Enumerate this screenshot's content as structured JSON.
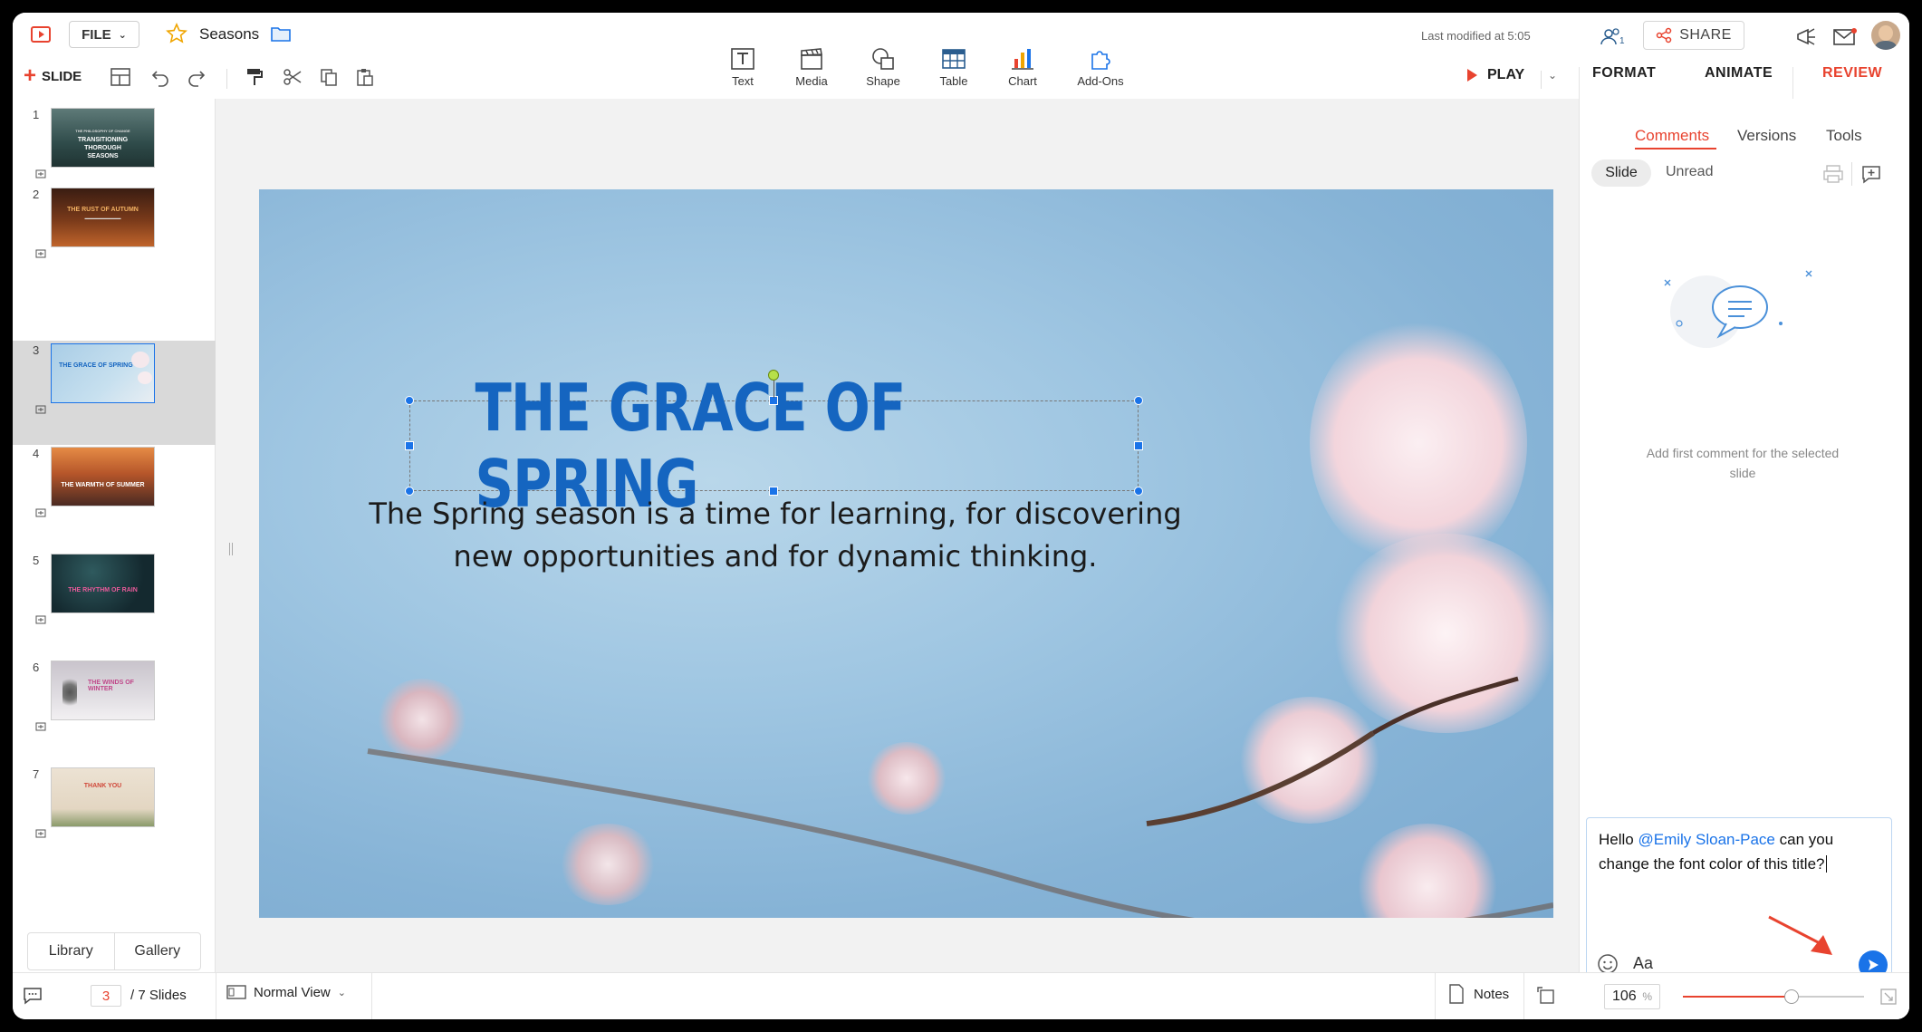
{
  "app": {
    "doc_title": "Seasons",
    "last_modified": "Last modified at 5:05",
    "file_label": "FILE",
    "share_label": "SHARE",
    "collaborators_count": "1"
  },
  "toolbar": {
    "slide_label": "SLIDE",
    "play_label": "PLAY",
    "insert_tools": [
      {
        "label": "Text"
      },
      {
        "label": "Media"
      },
      {
        "label": "Shape"
      },
      {
        "label": "Table"
      },
      {
        "label": "Chart"
      },
      {
        "label": "Add-Ons"
      }
    ]
  },
  "right_tabs": {
    "format": "FORMAT",
    "animate": "ANIMATE",
    "review": "REVIEW",
    "active": "REVIEW"
  },
  "review": {
    "subtabs": [
      "Comments",
      "Versions",
      "Tools"
    ],
    "active_subtab": "Comments",
    "filters": [
      "Slide",
      "Unread"
    ],
    "active_filter": "Slide",
    "empty_state": "Add first comment for the selected slide",
    "comment_draft": {
      "prefix": "Hello ",
      "mention": "@Emily Sloan-Pace",
      "suffix": " can you change the font color of this title?"
    },
    "format_label": "Aa"
  },
  "slides": [
    {
      "number": "1",
      "title": "TRANSITIONING THOROUGH SEASONS",
      "kicker": "THE PHILOSOPHY OF CHANGE"
    },
    {
      "number": "2",
      "title": "THE RUST OF AUTUMN"
    },
    {
      "number": "3",
      "title": "THE GRACE OF SPRING"
    },
    {
      "number": "4",
      "title": "THE WARMTH OF SUMMER"
    },
    {
      "number": "5",
      "title": "THE RHYTHM OF RAIN"
    },
    {
      "number": "6",
      "title": "THE WINDS OF WINTER"
    },
    {
      "number": "7",
      "title": "THANK YOU"
    }
  ],
  "current_slide": {
    "title": "THE GRACE OF SPRING",
    "body_line1": "The Spring season is a time for learning, for discovering",
    "body_line2": "new opportunities and for dynamic thinking."
  },
  "library": {
    "library_label": "Library",
    "gallery_label": "Gallery"
  },
  "status": {
    "current_page": "3",
    "total_label": "/ 7 Slides",
    "view_label": "Normal View",
    "notes_label": "Notes",
    "zoom_value": "106",
    "zoom_unit": "%",
    "zoom_level": 0.6
  },
  "colors": {
    "accent": "#e8432f",
    "title_blue": "#1565c0",
    "selection_blue": "#1a73e8",
    "mention_blue": "#1a73e8"
  }
}
